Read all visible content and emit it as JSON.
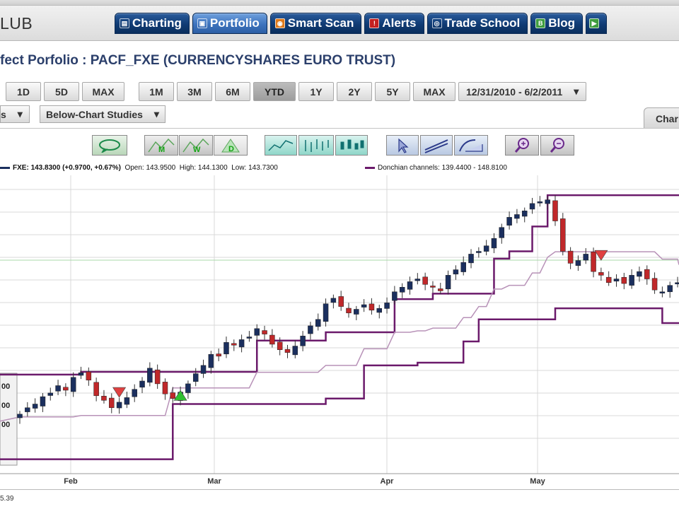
{
  "header": {
    "logo_text": "LUB",
    "tabs": [
      {
        "label": "Charting",
        "icon": "chart-icon",
        "active": false
      },
      {
        "label": "Portfolio",
        "icon": "portfolio-icon",
        "active": true
      },
      {
        "label": "Smart Scan",
        "icon": "scan-icon",
        "active": false
      },
      {
        "label": "Alerts",
        "icon": "alert-icon",
        "active": false
      },
      {
        "label": "Trade School",
        "icon": "school-icon",
        "active": false
      },
      {
        "label": "Blog",
        "icon": "blog-icon",
        "active": false
      }
    ]
  },
  "page": {
    "title": "fect Porfolio : PACF_FXE (CURRENCYSHARES EURO TRUST)"
  },
  "range_buttons": {
    "intraday": [
      "1D",
      "5D",
      "MAX"
    ],
    "history": [
      "1M",
      "3M",
      "6M",
      "YTD",
      "1Y",
      "2Y",
      "5Y",
      "MAX"
    ],
    "active": "YTD",
    "date_range": "12/31/2010 - 6/2/2011"
  },
  "studies": {
    "left_dropdown": "s",
    "below_chart": "Below-Chart Studies",
    "chart_tab": "Char"
  },
  "legend": {
    "symbol": "FXE:",
    "last": "143.8300",
    "change": "(+0.9700, +0.67%)",
    "open_label": "Open:",
    "open": "143.9500",
    "high_label": "High:",
    "high": "144.1300",
    "low_label": "Low:",
    "low": "143.7300",
    "study": "Donchian channels: 139.4400 - 148.8100",
    "symbol_color": "#1b2f5e",
    "study_color": "#6b1a6b"
  },
  "axis": {
    "months": [
      "Feb",
      "Mar",
      "Apr",
      "May"
    ],
    "y_labels_partial": [
      "00",
      "00",
      "00"
    ],
    "bottom_value": "5.39"
  },
  "chart_data": {
    "type": "candlestick",
    "colors": {
      "up": "#1b2f5e",
      "down": "#c0282a",
      "channel": "#6b1a6b",
      "mid": "#b892b8",
      "grid": "#d8d8d8",
      "hline": "#a8d8a8"
    },
    "candles_close": [
      129.5,
      130.2,
      130.6,
      131.4,
      131.8,
      132.6,
      132.1,
      133.5,
      134.0,
      133.2,
      131.5,
      131.0,
      130.2,
      130.8,
      131.3,
      132.2,
      133.1,
      134.5,
      132.8,
      131.7,
      131.2,
      131.9,
      132.8,
      133.9,
      134.8,
      136.0,
      135.8,
      137.3,
      137.0,
      137.6,
      137.9,
      138.8,
      138.2,
      137.1,
      136.5,
      136.2,
      136.9,
      138.0,
      139.1,
      139.8,
      141.5,
      142.1,
      141.2,
      140.5,
      140.9,
      141.4,
      140.8,
      141.0,
      141.6,
      142.8,
      143.3,
      143.9,
      144.2,
      143.6,
      143.3,
      142.9,
      144.6,
      145.2,
      146.0,
      146.9,
      147.2,
      147.8,
      148.6,
      149.8,
      150.9,
      151.2,
      151.6,
      152.4,
      152.6,
      152.8,
      150.5,
      147.2,
      145.9,
      146.2,
      146.9,
      145.0,
      144.6,
      143.8,
      144.2,
      143.7,
      144.6,
      145.0,
      144.2,
      143.0,
      142.8,
      143.5,
      143.8
    ],
    "donchian_upper_segments": [
      [
        0,
        133.8
      ],
      [
        8,
        134.1
      ],
      [
        25,
        134.1
      ],
      [
        31,
        137.5
      ],
      [
        40,
        138.4
      ],
      [
        49,
        142.0
      ],
      [
        54,
        142.6
      ],
      [
        62,
        146.4
      ],
      [
        64,
        147.2
      ],
      [
        67,
        149.9
      ],
      [
        69,
        153.3
      ],
      [
        87,
        153.3
      ]
    ],
    "donchian_lower_segments": [
      [
        0,
        124.6
      ],
      [
        16,
        124.6
      ],
      [
        20,
        130.6
      ],
      [
        40,
        131.2
      ],
      [
        45,
        134.8
      ],
      [
        52,
        135.1
      ],
      [
        58,
        137.4
      ],
      [
        60,
        139.8
      ],
      [
        70,
        141.0
      ],
      [
        80,
        141.0
      ],
      [
        84,
        139.4
      ],
      [
        87,
        139.4
      ]
    ],
    "ylim": [
      123.8,
      155.0
    ]
  }
}
